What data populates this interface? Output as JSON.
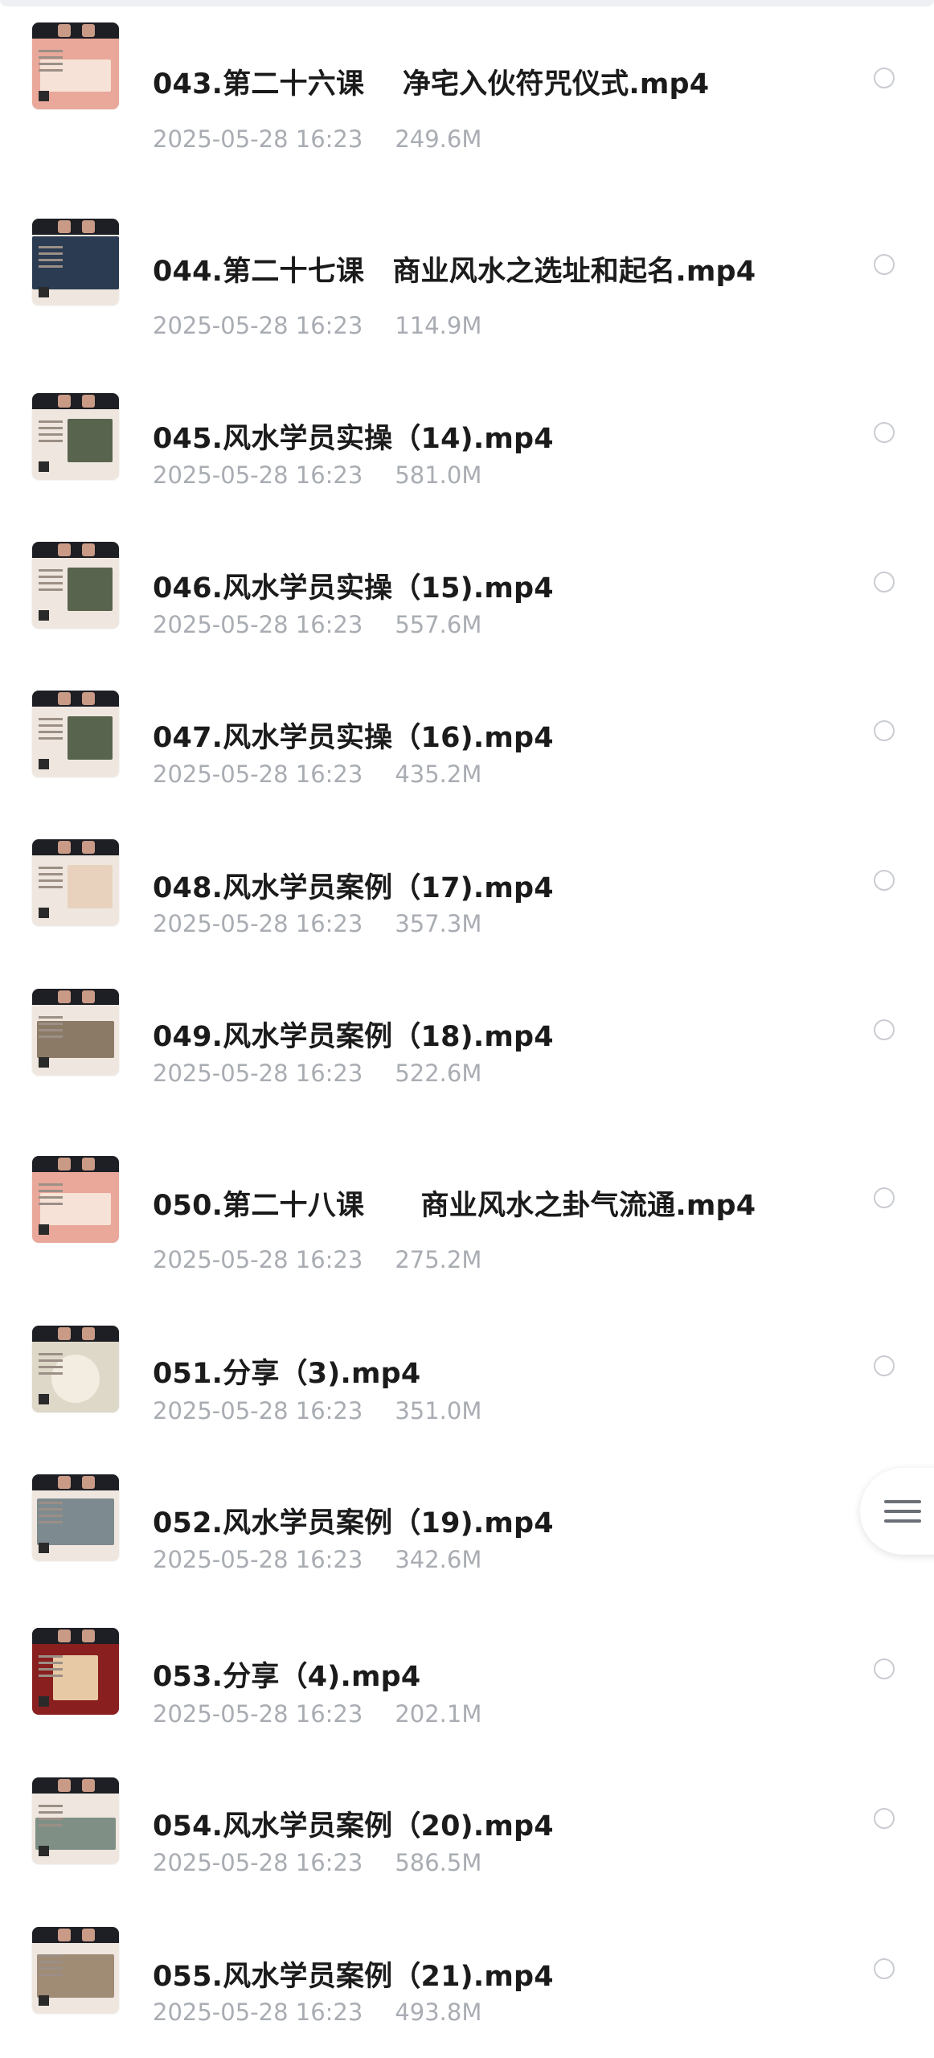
{
  "files": [
    {
      "name": "043.第二十六课　 净宅入伙符咒仪式.mp4",
      "date": "2025-05-28 16:23",
      "size": "249.6M",
      "thumb": "t-red"
    },
    {
      "name": "044.第二十七课　商业风水之选址和起名.mp4",
      "date": "2025-05-28 16:23",
      "size": "114.9M",
      "thumb": "t-dark"
    },
    {
      "name": "045.风水学员实操（14).mp4",
      "date": "2025-05-28 16:23",
      "size": "581.0M",
      "thumb": "t-default"
    },
    {
      "name": "046.风水学员实操（15).mp4",
      "date": "2025-05-28 16:23",
      "size": "557.6M",
      "thumb": "t-default"
    },
    {
      "name": "047.风水学员实操（16).mp4",
      "date": "2025-05-28 16:23",
      "size": "435.2M",
      "thumb": "t-default"
    },
    {
      "name": "048.风水学员案例（17).mp4",
      "date": "2025-05-28 16:23",
      "size": "357.3M",
      "thumb": "t-plan"
    },
    {
      "name": "049.风水学员案例（18).mp4",
      "date": "2025-05-28 16:23",
      "size": "522.6M",
      "thumb": "t-photos"
    },
    {
      "name": "050.第二十八课　　商业风水之卦气流通.mp4",
      "date": "2025-05-28 16:23",
      "size": "275.2M",
      "thumb": "t-red"
    },
    {
      "name": "051.分享（3).mp4",
      "date": "2025-05-28 16:23",
      "size": "351.0M",
      "thumb": "t-share"
    },
    {
      "name": "052.风水学员案例（19).mp4",
      "date": "2025-05-28 16:23",
      "size": "342.6M",
      "thumb": "t-building"
    },
    {
      "name": "053.分享（4).mp4",
      "date": "2025-05-28 16:23",
      "size": "202.1M",
      "thumb": "t-maroon"
    },
    {
      "name": "054.风水学员案例（20).mp4",
      "date": "2025-05-28 16:23",
      "size": "586.5M",
      "thumb": "t-aerial"
    },
    {
      "name": "055.风水学员案例（21).mp4",
      "date": "2025-05-28 16:23",
      "size": "493.8M",
      "thumb": "t-rooms"
    }
  ],
  "icons": {
    "row_select": "radio-circle-icon",
    "floating_menu": "menu-lines-icon"
  },
  "colors": {
    "title": "#1b1b1b",
    "meta": "#a9adb3",
    "radio_border": "#c9ccd1"
  }
}
